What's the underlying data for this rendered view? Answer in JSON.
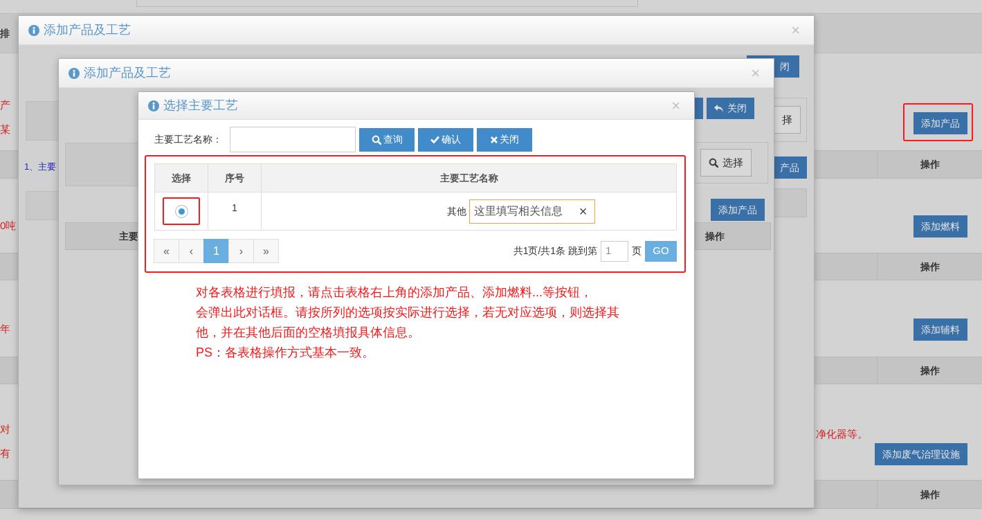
{
  "page": {
    "header_fragment": "排",
    "rows": [
      {
        "kind": "action",
        "texts": [
          "产",
          "某"
        ],
        "button": "添加产品",
        "highlighted": true
      },
      {
        "kind": "header",
        "label": "操作"
      },
      {
        "kind": "action",
        "texts": [
          "0吨"
        ],
        "button": "添加燃料",
        "highlighted": false
      },
      {
        "kind": "header",
        "label": "操作"
      },
      {
        "kind": "action",
        "texts": [
          "年"
        ],
        "button": "添加辅料",
        "highlighted": false
      },
      {
        "kind": "header",
        "label": "操作"
      },
      {
        "kind": "action",
        "texts": [
          "对",
          "有"
        ],
        "note": "净化器等。",
        "button": "添加废气治理设施",
        "highlighted": false
      },
      {
        "kind": "header",
        "label": "操作"
      }
    ]
  },
  "outer_dialog": {
    "title": "添加产品及工艺",
    "close": "×",
    "note": "1、主要",
    "close_button": "闭",
    "select_button": "择",
    "add_button": "产品"
  },
  "middle_dialog": {
    "title": "添加产品及工艺",
    "close": "×",
    "header_fragment": "主要",
    "close_button": "关闭",
    "select_button": "选择",
    "add_button": "添加产品",
    "header_action": "操作"
  },
  "select_dialog": {
    "title": "选择主要工艺",
    "close": "×",
    "search_label": "主要工艺名称：",
    "buttons": [
      {
        "kind": "search",
        "label": "查询"
      },
      {
        "kind": "confirm",
        "label": "确认"
      },
      {
        "kind": "close",
        "label": "关闭"
      }
    ],
    "table": {
      "highlighted": true,
      "columns": [
        "选择",
        "序号",
        "主要工艺名称"
      ],
      "rows": [
        {
          "selected": true,
          "highlighted": true,
          "index": "1",
          "label": "其他",
          "value": "这里填写相关信息",
          "clear": "×"
        }
      ]
    },
    "pagination": {
      "first": "«",
      "prev": "‹",
      "pages": [
        {
          "label": "1",
          "selected": true
        }
      ],
      "next": "›",
      "last": "»",
      "summary": "共1页/共1条 跳到第",
      "jump_value": "1",
      "unit": "页",
      "go": "GO"
    },
    "note_lines": [
      "对各表格进行填报，请点击表格右上角的添加产品、添加燃料...等按钮，",
      "会弹出此对话框。请按所列的选项按实际进行选择，若无对应选项，则选择其",
      "他，并在其他后面的空格填报具体信息。",
      "PS：各表格操作方式基本一致。"
    ]
  }
}
